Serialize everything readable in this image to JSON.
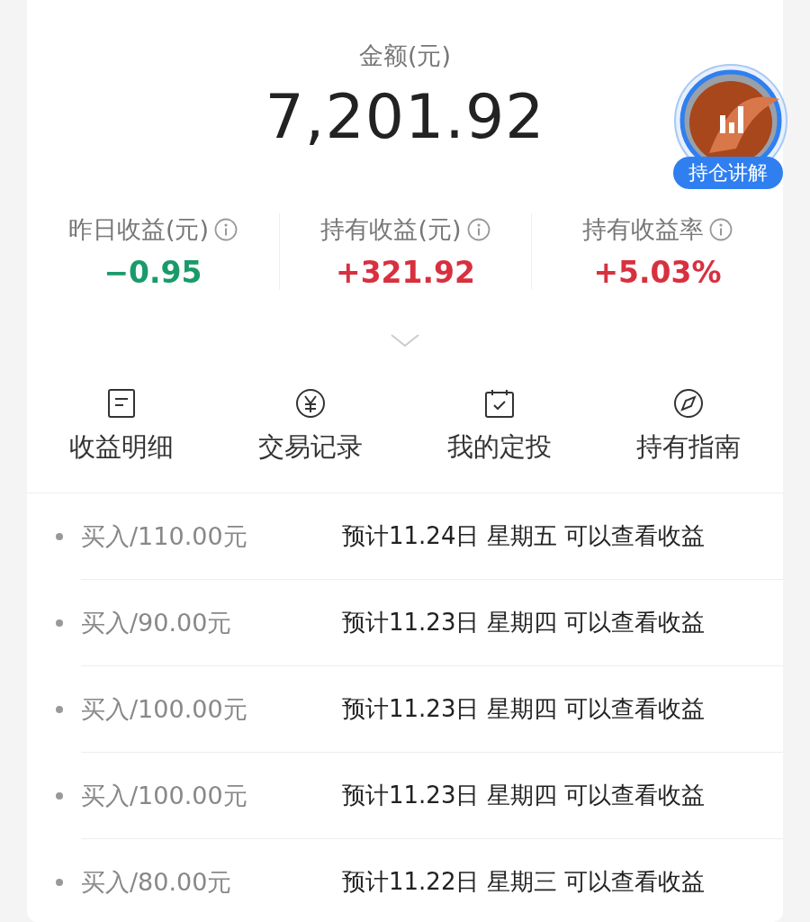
{
  "balance": {
    "label": "金额(元)",
    "amount": "7,201.92"
  },
  "explain_badge": {
    "label": "持仓讲解"
  },
  "stats": [
    {
      "label": "昨日收益(元)",
      "value": "−0.95",
      "color": "#1a9a6a"
    },
    {
      "label": "持有收益(元)",
      "value": "+321.92",
      "color": "#d8303f"
    },
    {
      "label": "持有收益率",
      "value": "+5.03%",
      "color": "#d8303f"
    }
  ],
  "shortcuts": [
    {
      "label": "收益明细"
    },
    {
      "label": "交易记录"
    },
    {
      "label": "我的定投"
    },
    {
      "label": "持有指南"
    }
  ],
  "transactions": [
    {
      "amount": "买入/110.00元",
      "note": "预计11.24日 星期五 可以查看收益"
    },
    {
      "amount": "买入/90.00元",
      "note": "预计11.23日 星期四 可以查看收益"
    },
    {
      "amount": "买入/100.00元",
      "note": "预计11.23日 星期四 可以查看收益"
    },
    {
      "amount": "买入/100.00元",
      "note": "预计11.23日 星期四 可以查看收益"
    },
    {
      "amount": "买入/80.00元",
      "note": "预计11.22日 星期三 可以查看收益"
    }
  ]
}
